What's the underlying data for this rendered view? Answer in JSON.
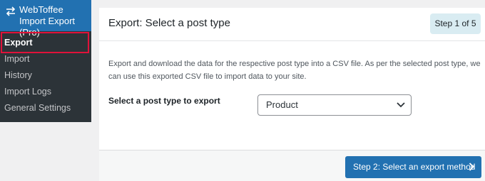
{
  "sidebar": {
    "plugin_title": "WebToffee Import Export (Pro)",
    "items": [
      {
        "label": "Export",
        "active": true
      },
      {
        "label": "Import",
        "active": false
      },
      {
        "label": "History",
        "active": false
      },
      {
        "label": "Import Logs",
        "active": false
      },
      {
        "label": "General Settings",
        "active": false
      }
    ]
  },
  "main": {
    "title": "Export: Select a post type",
    "step_badge": "Step 1 of 5",
    "description": "Export and download the data for the respective post type into a CSV file. As per the selected post type, we can use this exported CSV file to import data to your site.",
    "field_label": "Select a post type to export",
    "select_value": "Product"
  },
  "footer": {
    "next_button": "Step 2: Select an export method"
  },
  "colors": {
    "sidebar_bg": "#2c3338",
    "accent": "#2271b1",
    "highlight": "#e0123a",
    "badge_bg": "#d9ecf2"
  }
}
